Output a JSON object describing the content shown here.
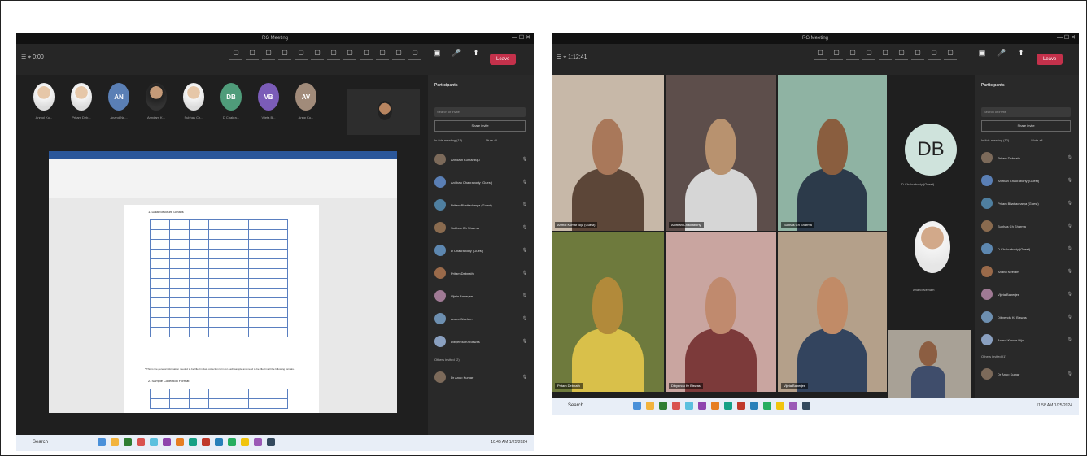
{
  "left": {
    "window_title": "RG Meeting",
    "toolbar": {
      "app_label": "☰ ⌖ 0:00",
      "icons": [
        "chat",
        "people",
        "raise",
        "react",
        "view",
        "notes",
        "whiteboard",
        "apps",
        "more",
        "camera",
        "mic",
        "share"
      ],
      "leave_label": "Leave"
    },
    "avatars": [
      {
        "initials": "",
        "type": "photo",
        "name": "Anmol Ku..."
      },
      {
        "initials": "",
        "type": "photo",
        "name": "Pritam Deb..."
      },
      {
        "initials": "AN",
        "type": "initials",
        "color": "#5a7fb5",
        "name": "Anand Ne..."
      },
      {
        "initials": "",
        "type": "dark",
        "name": "Arindam K..."
      },
      {
        "initials": "",
        "type": "photo",
        "name": "Subhas Ch..."
      },
      {
        "initials": "DB",
        "type": "initials",
        "color": "#4f9c7a",
        "name": "D Chakra..."
      },
      {
        "initials": "VB",
        "type": "initials",
        "color": "#7b5cb8",
        "name": "Vijeta B..."
      },
      {
        "initials": "AV",
        "type": "initials",
        "color": "#a18b7a",
        "name": "Anup Ku..."
      }
    ],
    "document": {
      "heading1": "1.  Data Structure Details",
      "paragraph": "* This is the general information needed to be filled in data collection form for each sample and need to be filled in all the following formats.",
      "heading2": "2.  Sample Collection Format"
    },
    "people_panel": {
      "title": "Participants",
      "search": "Search or invite",
      "share_button": "Share invite",
      "section_in_meeting": "In this meeting (11)",
      "mute_all": "Mute all",
      "participants": [
        "Arindam Kumar Biju",
        "Anirban Chakraborty (Guest)",
        "Pritam Bhattacharya (Guest)",
        "Subhas Ch Sharma",
        "D Chakraborty (Guest)",
        "Pritam Debnath",
        "Vijeta Banerjee",
        "Anand Neelam",
        "Dibyendu Kr Biswas"
      ],
      "section_others": "Others invited (2)",
      "others": [
        "Dr Anup Kumar"
      ]
    },
    "taskbar": {
      "search": "Search",
      "time": "10:45 AM",
      "date": "1/25/2024"
    }
  },
  "right": {
    "window_title": "RG Meeting",
    "toolbar": {
      "app_label": "☰ ⌖ 1:12:41",
      "leave_label": "Leave"
    },
    "tiles": [
      {
        "label": "Anmol Kumar Biju (Guest)",
        "bg": "#c7b8a8",
        "face": "#a9785a",
        "shirt": "#5c4638"
      },
      {
        "label": "Anirban Chakraborty",
        "bg": "#5d4e4b",
        "face": "#b8926f",
        "shirt": "#d6d6d6"
      },
      {
        "label": "Subhas Ch Sharma",
        "bg": "#8fb3a3",
        "face": "#8a5e3f",
        "shirt": "#2c3a4a"
      },
      {
        "label": "Pritam Debnath",
        "bg": "#6e7a3d",
        "face": "#b28a3a",
        "shirt": "#d9c04a"
      },
      {
        "label": "Dibyendu Kr Biswas",
        "bg": "#c9a5a0",
        "face": "#c08a6e",
        "shirt": "#7c3a3a"
      },
      {
        "label": "Vijeta Banerjee",
        "bg": "#b4a08a",
        "face": "#c18b67",
        "shirt": "#33445e"
      }
    ],
    "db_tile": {
      "initials": "DB",
      "name": "D Chakraborty (Guest)"
    },
    "small_tile_name": "Anand Neelam",
    "people_panel": {
      "title": "Participants",
      "search": "Search or invite",
      "share_button": "Share invite",
      "section_in_meeting": "In this meeting (12)",
      "mute_all": "Mute all",
      "participants": [
        "Pritam Debnath",
        "Anirban Chakraborty (Guest)",
        "Pritam Bhattacharya (Guest)",
        "Subhas Ch Sharma",
        "D Chakraborty (Guest)",
        "Anand Neelam",
        "Vijeta Banerjee",
        "Dibyendu Kr Biswas",
        "Anmol Kumar Biju"
      ],
      "section_others": "Others invited (1)",
      "others": [
        "Dr Anup Kumar"
      ]
    },
    "taskbar": {
      "search": "Search",
      "time": "11:58 AM",
      "date": "1/25/2024"
    }
  },
  "colors": {
    "teams_dark": "#1f1f1f",
    "leave_red": "#c4314b",
    "word_blue": "#2b579a"
  }
}
